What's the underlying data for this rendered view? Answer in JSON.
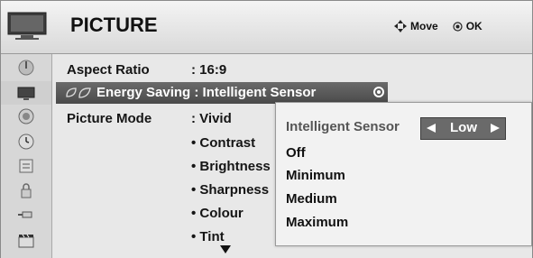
{
  "header": {
    "title": "PICTURE",
    "move_label": "Move",
    "ok_label": "OK"
  },
  "sidebar": {
    "items": [
      {
        "name": "picture-category-icon"
      },
      {
        "name": "monitor-icon"
      },
      {
        "name": "audio-icon"
      },
      {
        "name": "timer-icon"
      },
      {
        "name": "settings-icon"
      },
      {
        "name": "lock-icon"
      },
      {
        "name": "input-icon"
      },
      {
        "name": "clapper-icon"
      }
    ]
  },
  "menu": {
    "aspect_ratio": {
      "label": "Aspect Ratio",
      "value": ": 16:9"
    },
    "energy_saving": {
      "label": "Energy Saving : Intelligent Sensor"
    },
    "picture_mode": {
      "label": "Picture Mode",
      "value": ": Vivid"
    },
    "sub_items": [
      "• Contrast",
      "• Brightness",
      "• Sharpness",
      "• Colour",
      "• Tint"
    ]
  },
  "popup": {
    "title": "Intelligent Sensor",
    "selected_value": "Low",
    "options": [
      "Off",
      "Minimum",
      "Medium",
      "Maximum"
    ]
  }
}
